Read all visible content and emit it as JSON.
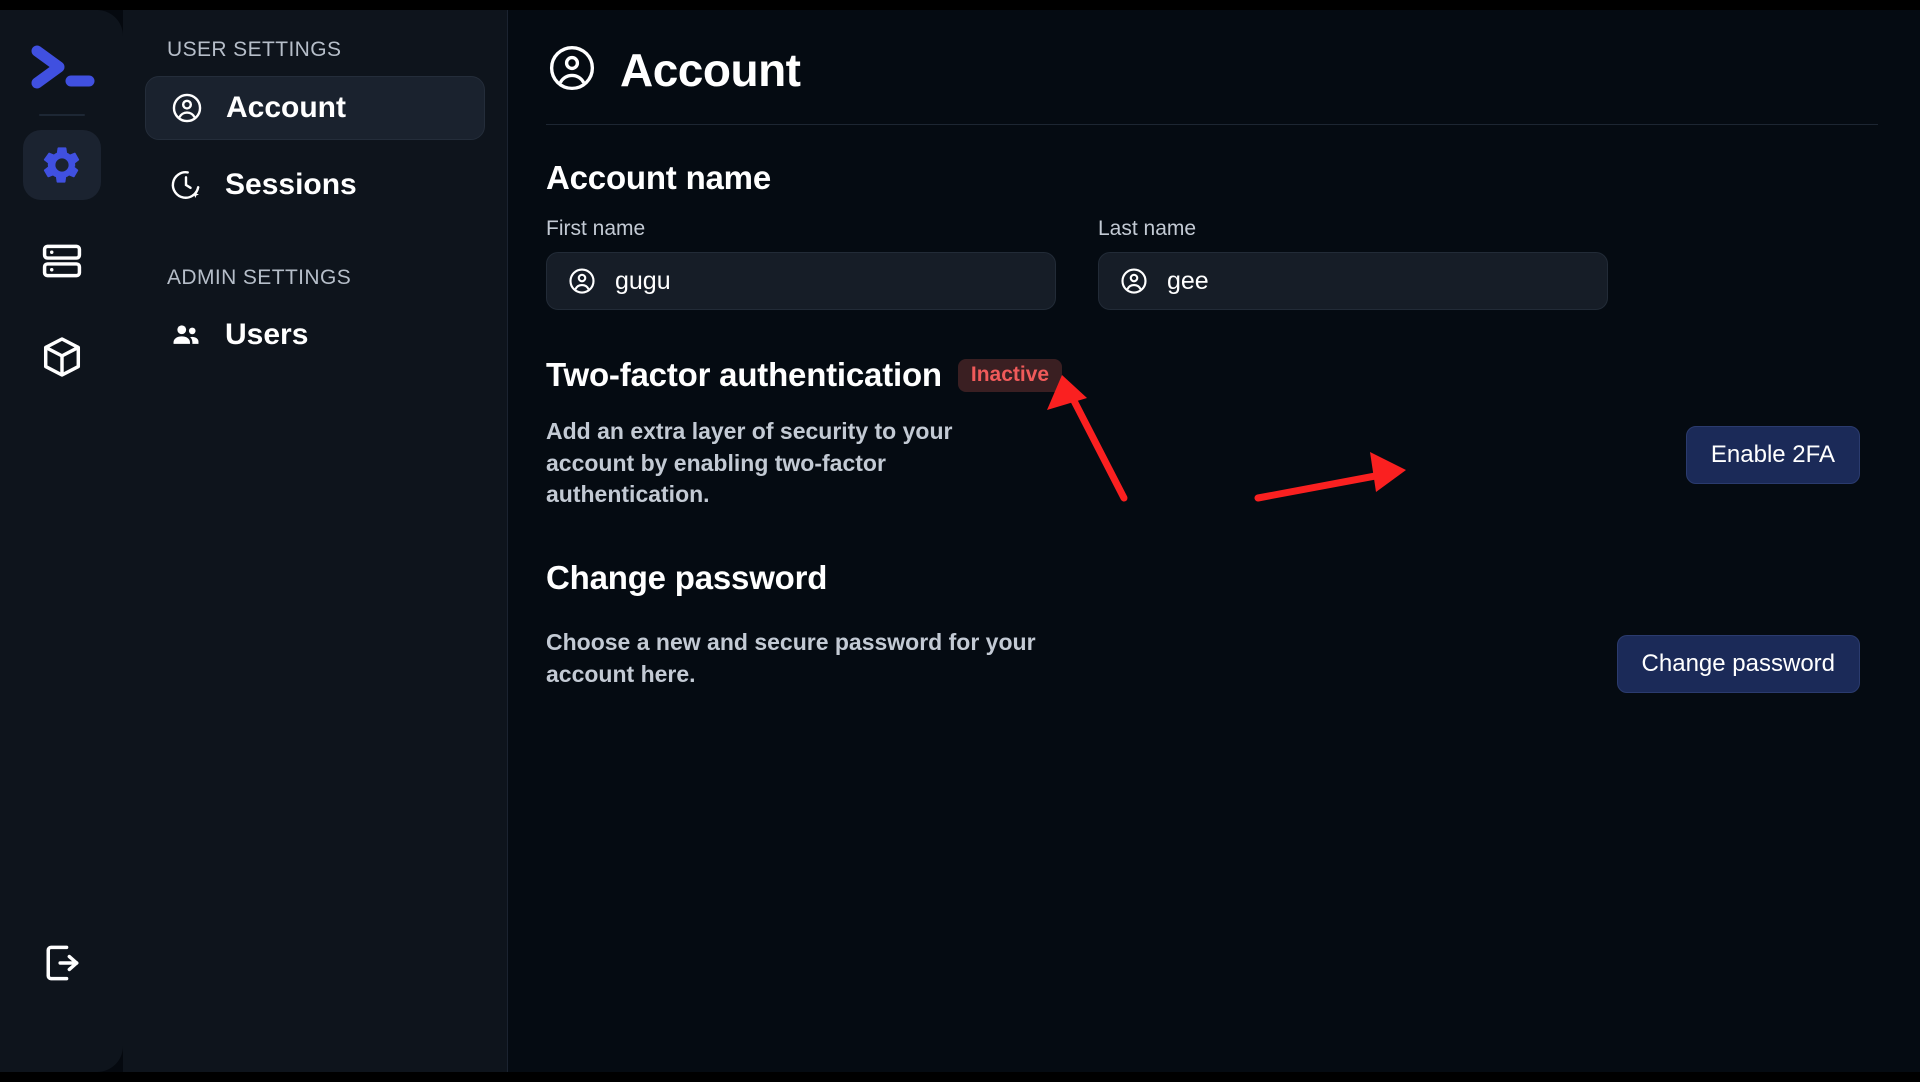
{
  "rail": {
    "logo_icon": "terminal-prompt-logo",
    "items": [
      {
        "icon": "gear-icon",
        "name": "settings",
        "active": true
      },
      {
        "icon": "server-stack-icon",
        "name": "servers",
        "active": false
      },
      {
        "icon": "cube-icon",
        "name": "packages",
        "active": false
      }
    ],
    "bottom": {
      "icon": "logout-icon",
      "name": "logout"
    }
  },
  "sidebar": {
    "groups": [
      {
        "label": "USER SETTINGS",
        "items": [
          {
            "label": "Account",
            "icon": "user-circle-icon",
            "active": true
          },
          {
            "label": "Sessions",
            "icon": "clock-sparkle-icon",
            "active": false
          }
        ]
      },
      {
        "label": "ADMIN SETTINGS",
        "items": [
          {
            "label": "Users",
            "icon": "users-group-icon",
            "active": false
          }
        ]
      }
    ]
  },
  "page": {
    "title": "Account",
    "title_icon": "user-circle-icon"
  },
  "account_name": {
    "heading": "Account name",
    "first_name": {
      "label": "First name",
      "value": "gugu",
      "placeholder": "First name",
      "icon": "user-circle-icon"
    },
    "last_name": {
      "label": "Last name",
      "value": "gee",
      "placeholder": "Last name",
      "icon": "user-circle-icon"
    }
  },
  "two_factor": {
    "heading": "Two-factor authentication",
    "status_badge": "Inactive",
    "description": "Add an extra layer of security to your account by enabling two-factor authentication.",
    "button": "Enable 2FA"
  },
  "change_password": {
    "heading": "Change password",
    "description": "Choose a new and secure password for your account here.",
    "button": "Change password"
  },
  "colors": {
    "accent_blue": "#4050e0",
    "button_blue": "#1b2a58",
    "badge_text": "#f05a5a",
    "badge_bg": "#3a1f22",
    "annotation_red": "#fa2020",
    "sidebar_bg": "#0e141c",
    "content_bg": "#050b12"
  },
  "annotations": [
    {
      "name": "arrow-to-inactive-badge",
      "color": "#fa2020"
    },
    {
      "name": "arrow-to-enable-2fa-button",
      "color": "#fa2020"
    }
  ]
}
